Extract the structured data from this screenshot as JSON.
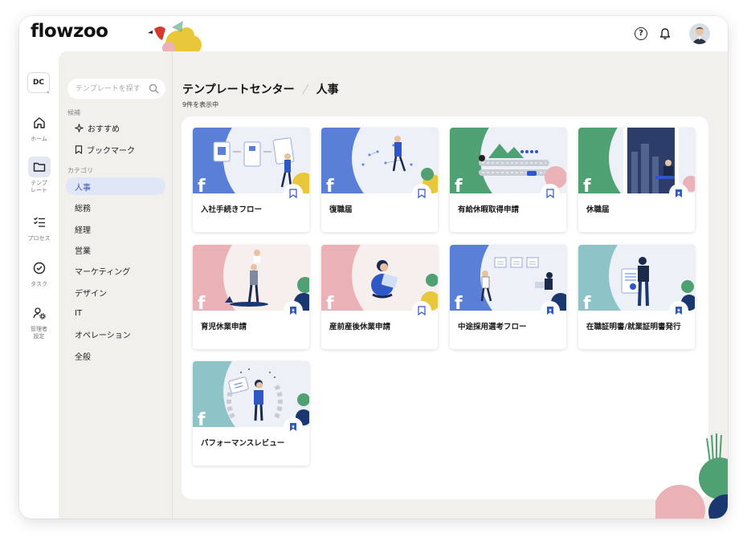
{
  "brand": {
    "logo_text": "flowzoo"
  },
  "header": {
    "help_label": "?"
  },
  "rail": {
    "workspace": "DC",
    "items": [
      {
        "label": "ホーム",
        "icon": "home-icon"
      },
      {
        "label": "テンプ\nレート",
        "icon": "folder-icon"
      },
      {
        "label": "プロセス",
        "icon": "checklist-icon"
      },
      {
        "label": "タスク",
        "icon": "check-circle-icon"
      },
      {
        "label": "管理者\n設定",
        "icon": "user-gear-icon"
      }
    ]
  },
  "sidebar": {
    "search_placeholder": "テンプレートを探す",
    "candidates_label": "候補",
    "recommended": "おすすめ",
    "bookmark": "ブックマーク",
    "category_label": "カテゴリ",
    "categories": [
      "人事",
      "総務",
      "経理",
      "営業",
      "マーケティング",
      "デザイン",
      "IT",
      "オペレーション",
      "全般"
    ]
  },
  "main": {
    "title": "テンプレートセンター",
    "breadcrumb_current": "人事",
    "result_count": "9件を表示中"
  },
  "cards": [
    {
      "title": "入社手続きフロー",
      "bookmarked": false,
      "bg": "#5a7fd6"
    },
    {
      "title": "復職届",
      "bookmarked": false,
      "bg": "#5a7fd6"
    },
    {
      "title": "有給休暇取得申請",
      "bookmarked": false,
      "bg": "#4fa073"
    },
    {
      "title": "休職届",
      "bookmarked": true,
      "bg": "#4fa073"
    },
    {
      "title": "育児休業申請",
      "bookmarked": true,
      "bg": "#eab2b6"
    },
    {
      "title": "産前産後休業申請",
      "bookmarked": false,
      "bg": "#eab2b6"
    },
    {
      "title": "中途採用選考フロー",
      "bookmarked": true,
      "bg": "#5a7fd6"
    },
    {
      "title": "在職証明書/就業証明書発行",
      "bookmarked": true,
      "bg": "#8ec3c7"
    },
    {
      "title": "パフォーマンスレビュー",
      "bookmarked": true,
      "bg": "#8ec3c7"
    }
  ],
  "colors": {
    "accent": "#2f58c6",
    "app_bg": "#f1f0ec",
    "active_item_bg": "#e1e6f6"
  }
}
